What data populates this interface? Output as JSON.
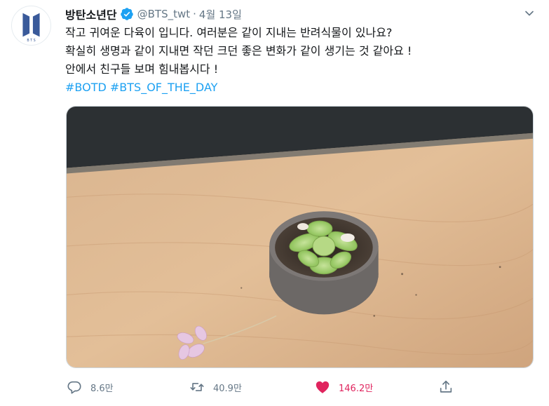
{
  "tweet": {
    "display_name": "방탄소년단",
    "handle": "@BTS_twt",
    "separator": "·",
    "date": "4월 13일",
    "avatar_icon": "bts-logo-icon",
    "verified_icon": "verified-badge-icon",
    "text_lines": [
      "작고 귀여운 다육이 입니다. 여러분은 같이 지내는 반려식물이 있나요?",
      "확실히 생명과 같이 지내면 작던 크던 좋은 변화가 같이 생기는 것 같아요 !",
      "안에서 친구들 보며 힘내봅시다 !"
    ],
    "hashtags": [
      "#BOTD",
      "#BTS_OF_THE_DAY"
    ],
    "media_description_icon": "succulent-photo",
    "actions": {
      "reply": {
        "icon": "reply-icon",
        "count": "8.6만"
      },
      "retweet": {
        "icon": "retweet-icon",
        "count": "40.9만"
      },
      "like": {
        "icon": "heart-icon",
        "count": "146.2만",
        "active": true,
        "color": "#e0245e"
      },
      "share": {
        "icon": "share-icon"
      }
    }
  },
  "colors": {
    "link": "#1da1f2",
    "secondary_text": "#657786",
    "verified": "#1da1f2",
    "like_active": "#e0245e"
  }
}
